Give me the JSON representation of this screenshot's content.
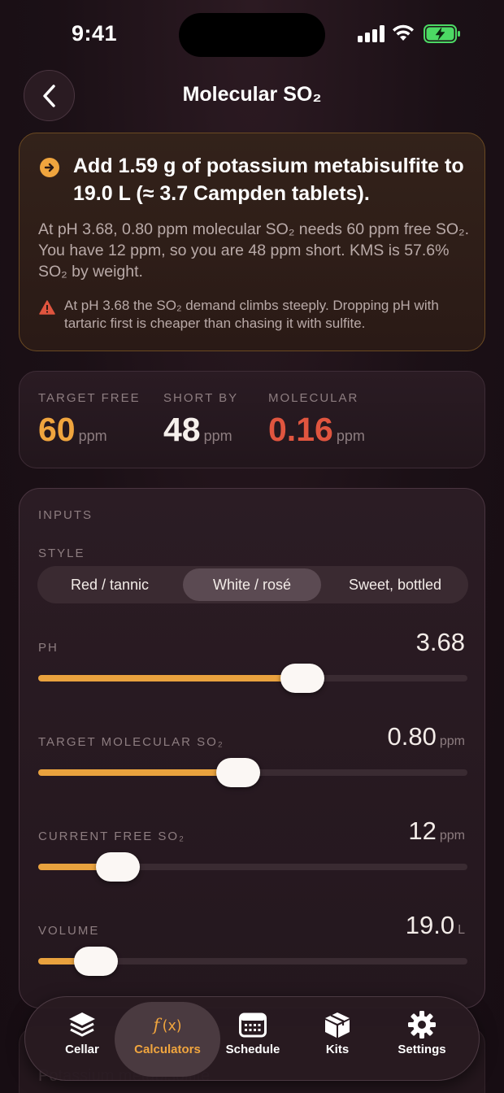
{
  "status_bar": {
    "time": "9:41"
  },
  "header": {
    "title": "Molecular SO₂",
    "back_icon": "chevron-left-icon"
  },
  "alert": {
    "icon": "arrow-right-circle-icon",
    "headline": "Add 1.59 g of potassium metabisulfite to 19.0 L (≈ 3.7 Campden tablets).",
    "body": "At pH 3.68, 0.80 ppm molecular SO₂ needs 60 ppm free SO₂. You have 12 ppm, so you are 48 ppm short. KMS is 57.6% SO₂ by weight.",
    "warning_icon": "warning-triangle-icon",
    "warning": "At pH 3.68 the SO₂ demand climbs steeply. Dropping pH with tartaric first is cheaper than chasing it with sulfite.",
    "accent_color": "#f0a53e",
    "warning_color": "#e0553f"
  },
  "stats": [
    {
      "label": "TARGET FREE",
      "value": "60",
      "unit": "ppm",
      "color": "#f0a53e"
    },
    {
      "label": "SHORT BY",
      "value": "48",
      "unit": "ppm",
      "color": "#f6f0ec"
    },
    {
      "label": "MOLECULAR",
      "value": "0.16",
      "unit": "ppm",
      "color": "#e0553f"
    }
  ],
  "inputs": {
    "section_label": "INPUTS",
    "style": {
      "label": "STYLE",
      "options": [
        "Red / tannic",
        "White / rosé",
        "Sweet, bottled"
      ],
      "selected": "White / rosé"
    },
    "sliders": [
      {
        "label": "PH",
        "value": "3.68",
        "unit": "",
        "fraction": 0.615
      },
      {
        "label": "TARGET MOLECULAR SO₂",
        "value": "0.80",
        "unit": "ppm",
        "fraction": 0.465
      },
      {
        "label": "CURRENT FREE SO₂",
        "value": "12",
        "unit": "ppm",
        "fraction": 0.185
      },
      {
        "label": "VOLUME",
        "value": "19.0",
        "unit": "L",
        "fraction": 0.135
      }
    ]
  },
  "behind_tab_text": "Potassium metabisulfite",
  "tabs": [
    {
      "label": "Cellar",
      "icon": "stack-layers-icon",
      "active": false
    },
    {
      "label": "Calculators",
      "icon": "function-fx-icon",
      "active": true
    },
    {
      "label": "Schedule",
      "icon": "calendar-icon",
      "active": false
    },
    {
      "label": "Kits",
      "icon": "box-icon",
      "active": false
    },
    {
      "label": "Settings",
      "icon": "gear-icon",
      "active": false
    }
  ],
  "colors": {
    "accent": "#f0a53e",
    "background": "#1a0f15",
    "danger": "#e0553f"
  }
}
